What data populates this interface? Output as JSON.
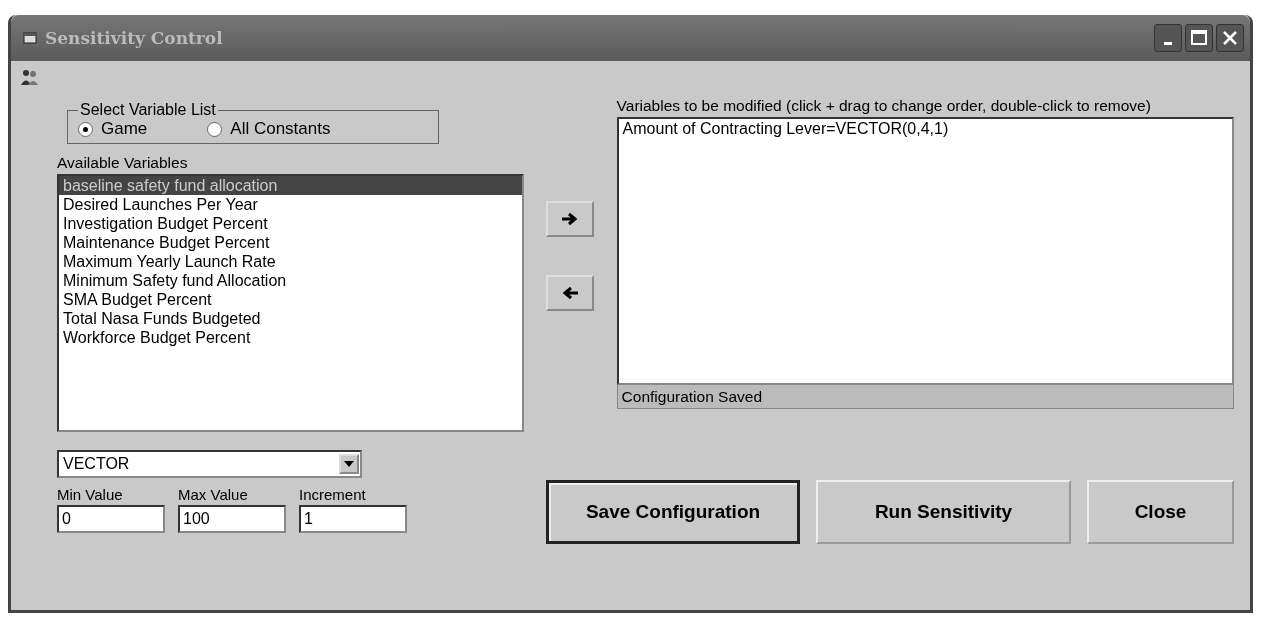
{
  "window": {
    "title": "Sensitivity Control"
  },
  "variable_list_group": {
    "title": "Select Variable List",
    "options": [
      {
        "label": "Game",
        "selected": true
      },
      {
        "label": "All Constants",
        "selected": false
      }
    ]
  },
  "available_variables": {
    "label": "Available Variables",
    "items": [
      {
        "label": "baseline safety fund allocation",
        "selected": true
      },
      {
        "label": "Desired Launches Per Year",
        "selected": false
      },
      {
        "label": "Investigation Budget Percent",
        "selected": false
      },
      {
        "label": "Maintenance Budget Percent",
        "selected": false
      },
      {
        "label": "Maximum Yearly Launch Rate",
        "selected": false
      },
      {
        "label": "Minimum Safety fund Allocation",
        "selected": false
      },
      {
        "label": "SMA Budget Percent",
        "selected": false
      },
      {
        "label": "Total Nasa Funds Budgeted",
        "selected": false
      },
      {
        "label": "Workforce Budget Percent",
        "selected": false
      }
    ]
  },
  "modified_variables": {
    "label": "Variables to be modified (click + drag to change order, double-click to remove)",
    "items": [
      {
        "label": "Amount of Contracting Lever=VECTOR(0,4,1)"
      }
    ]
  },
  "status": "Configuration Saved",
  "function_dropdown": {
    "value": "VECTOR"
  },
  "fields": [
    {
      "label": "Min Value",
      "value": "0"
    },
    {
      "label": "Max Value",
      "value": "100"
    },
    {
      "label": "Increment",
      "value": "1"
    }
  ],
  "buttons": [
    {
      "label": "Save Configuration",
      "default": true
    },
    {
      "label": "Run Sensitivity",
      "default": false
    },
    {
      "label": "Close",
      "default": false
    }
  ]
}
